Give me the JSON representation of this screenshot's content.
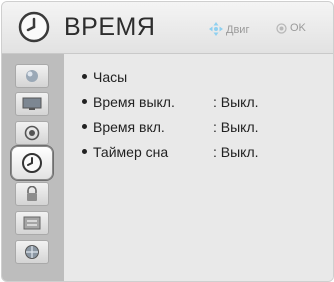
{
  "header": {
    "title": "ВРЕМЯ",
    "hint_move": "Двиг",
    "hint_ok": "OK"
  },
  "menu": [
    {
      "label": "Часы",
      "value": ""
    },
    {
      "label": "Время выкл.",
      "value": ": Выкл."
    },
    {
      "label": "Время вкл.",
      "value": ": Выкл."
    },
    {
      "label": "Таймер сна",
      "value": ": Выкл."
    }
  ],
  "sidebar_icons": [
    "picture-icon",
    "screen-icon",
    "audio-icon",
    "time-icon",
    "lock-icon",
    "option-icon",
    "network-icon"
  ],
  "active_sidebar": "time-icon"
}
